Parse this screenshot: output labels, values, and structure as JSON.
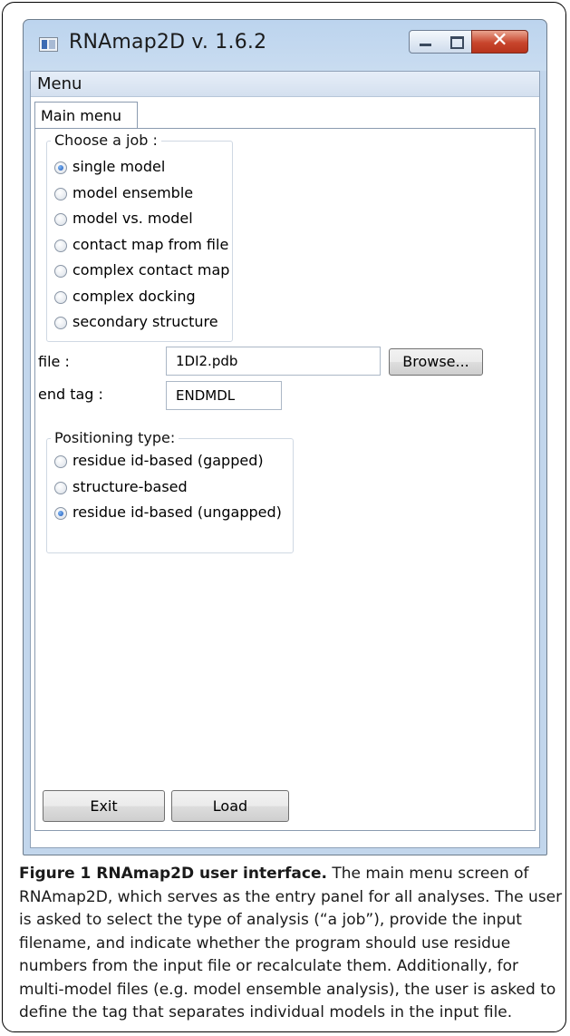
{
  "window": {
    "title": "RNAmap2D v. 1.6.2",
    "menu": "Menu",
    "tab": "Main menu"
  },
  "job_group": {
    "legend": "Choose a job :",
    "options": [
      {
        "label": "single model",
        "checked": true
      },
      {
        "label": "model ensemble",
        "checked": false
      },
      {
        "label": "model vs. model",
        "checked": false
      },
      {
        "label": "contact map from file",
        "checked": false
      },
      {
        "label": "complex contact map",
        "checked": false
      },
      {
        "label": "complex docking",
        "checked": false
      },
      {
        "label": "secondary structure",
        "checked": false
      }
    ]
  },
  "file_field": {
    "label": "file :",
    "value": "1DI2.pdb",
    "browse": "Browse..."
  },
  "end_tag_field": {
    "label": "end tag :",
    "value": "ENDMDL"
  },
  "positioning_group": {
    "legend": "Positioning type:",
    "options": [
      {
        "label": "residue id-based (gapped)",
        "checked": false
      },
      {
        "label": "structure-based",
        "checked": false
      },
      {
        "label": "residue id-based (ungapped)",
        "checked": true
      }
    ]
  },
  "buttons": {
    "exit": "Exit",
    "load": "Load"
  },
  "caption": {
    "title": "Figure 1 RNAmap2D user interface.",
    "text": " The main menu screen of RNAmap2D, which serves as the entry panel for all analyses. The user is asked to select the type of analysis (“a job”), provide the input filename, and indicate whether the program should use residue numbers from the input file or recalculate them. Additionally, for multi-model files (e.g. model ensemble analysis), the user is asked to define the tag that separates individual models in the input file."
  },
  "colors": {
    "title_bar": "#c9dcf0",
    "close_button": "#c8452c",
    "radio_selected": "#1b56b8"
  }
}
